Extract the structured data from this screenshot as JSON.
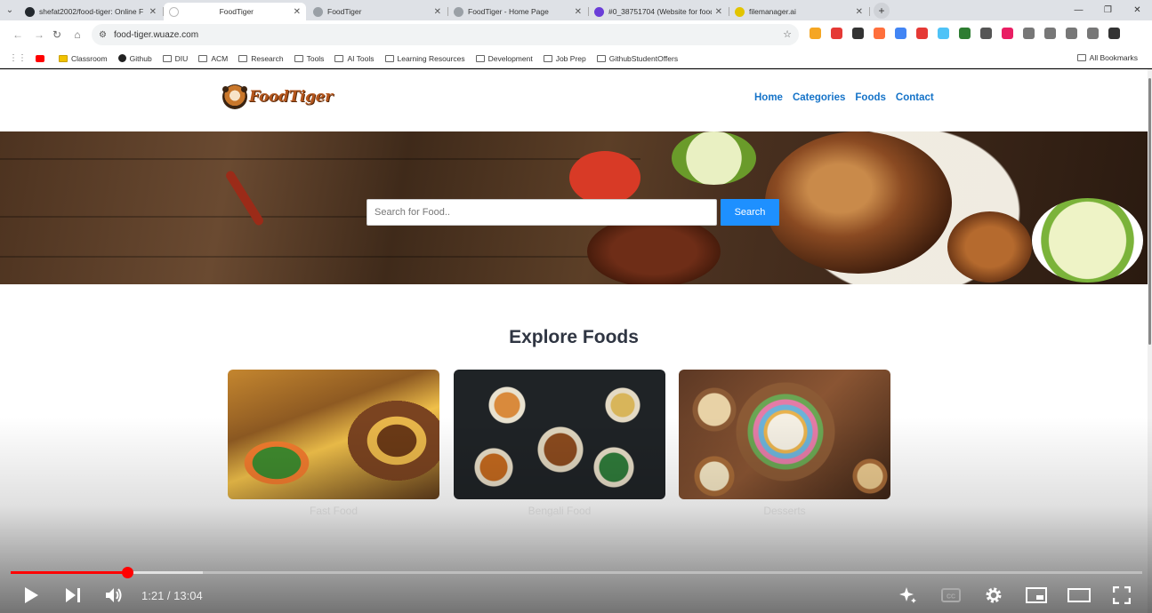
{
  "browser": {
    "tabs": [
      {
        "label": "shefat2002/food-tiger: Online F",
        "icon": "github-icon",
        "color": "#24292e",
        "active": false
      },
      {
        "label": "FoodTiger",
        "icon": "page-icon",
        "color": "#ffffff",
        "active": true
      },
      {
        "label": "FoodTiger",
        "icon": "globe-icon",
        "color": "#9aa0a6",
        "active": false
      },
      {
        "label": "FoodTiger - Home Page",
        "icon": "globe-icon",
        "color": "#9aa0a6",
        "active": false
      },
      {
        "label": "#0_38751704 (Website for food",
        "icon": "hostinger-icon",
        "color": "#6a3dd8",
        "active": false
      },
      {
        "label": "filemanager.ai",
        "icon": "filemanager-icon",
        "color": "#e2c400",
        "active": false
      }
    ],
    "url": "food-tiger.wuaze.com",
    "bookmarks": [
      {
        "label": "",
        "icon": "youtube-icon"
      },
      {
        "label": "Classroom",
        "icon": "classroom-icon"
      },
      {
        "label": "Github",
        "icon": "github-icon"
      },
      {
        "label": "DIU",
        "icon": "folder-icon"
      },
      {
        "label": "ACM",
        "icon": "folder-icon"
      },
      {
        "label": "Research",
        "icon": "folder-icon"
      },
      {
        "label": "Tools",
        "icon": "folder-icon"
      },
      {
        "label": "AI Tools",
        "icon": "folder-icon"
      },
      {
        "label": "Learning Resources",
        "icon": "folder-icon"
      },
      {
        "label": "Development",
        "icon": "folder-icon"
      },
      {
        "label": "Job Prep",
        "icon": "folder-icon"
      },
      {
        "label": "GithubStudentOffers",
        "icon": "folder-icon"
      }
    ],
    "all_bookmarks": "All Bookmarks",
    "extension_colors": [
      "#f5a623",
      "#e53935",
      "#333333",
      "#ff6f3c",
      "#4285f4",
      "#e53935",
      "#4fc3f7",
      "#2e7d32",
      "#555555",
      "#e91e63",
      "#777777",
      "#777777",
      "#777777",
      "#777777",
      "#333333"
    ]
  },
  "site": {
    "logo_text": "FoodTiger",
    "nav": [
      "Home",
      "Categories",
      "Foods",
      "Contact"
    ],
    "search": {
      "placeholder": "Search for Food..",
      "button": "Search"
    },
    "section_title": "Explore Foods",
    "categories": [
      "Fast Food",
      "Bengali Food",
      "Desserts"
    ],
    "accent_color": "#1e90ff",
    "link_color": "#1573c8"
  },
  "player": {
    "time": "1:21 / 13:04",
    "progress": 0.103,
    "buffered": 0.17,
    "progress_color": "#ff0000"
  }
}
